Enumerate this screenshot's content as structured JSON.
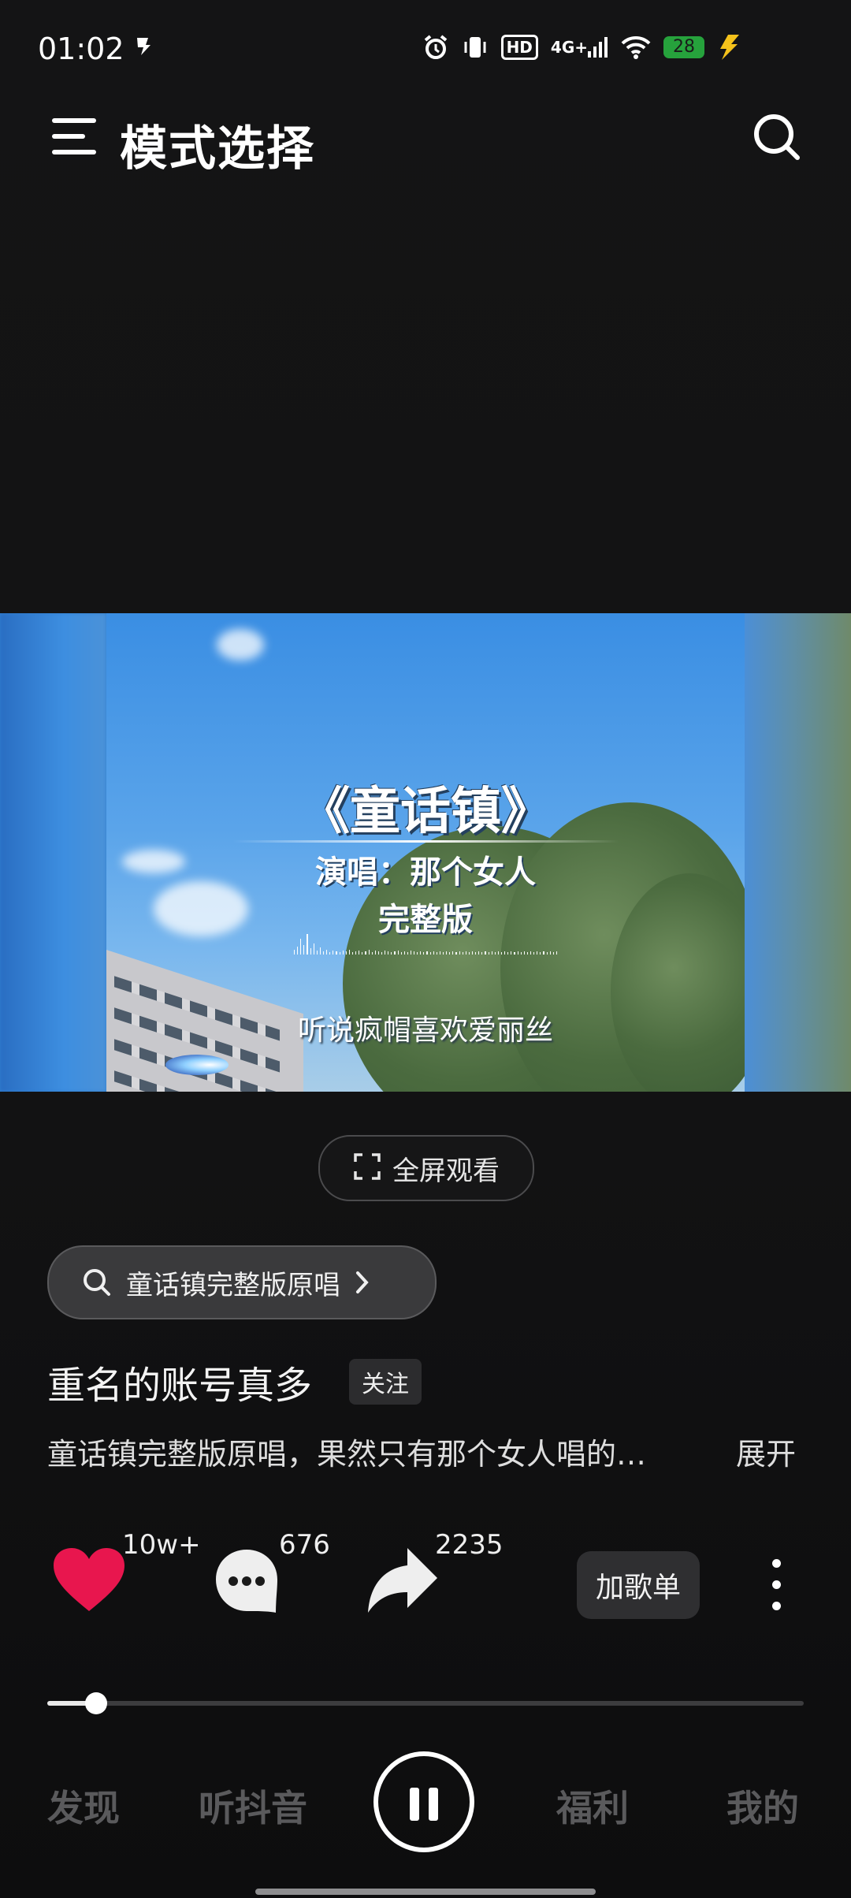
{
  "status_bar": {
    "time": "01:02",
    "network": "4G+",
    "hd": "HD",
    "battery": "28",
    "battery_color": "#26a23c",
    "icons": [
      "notification-icon",
      "alarm-icon",
      "vibrate-icon",
      "hd-icon",
      "signal-icon",
      "wifi-icon",
      "battery-icon",
      "charging-icon"
    ]
  },
  "header": {
    "title": "模式选择",
    "menu_icon": "menu-icon",
    "search_icon": "search-icon"
  },
  "video": {
    "title": "《童话镇》",
    "singer_line": "演唱：那个女人",
    "version_line": "完整版",
    "caption": "听说疯帽喜欢爱丽丝"
  },
  "fullscreen": {
    "label": "全屏观看",
    "icon": "fullscreen-icon"
  },
  "search_chip": {
    "label": "童话镇完整版原唱",
    "icon": "search-icon"
  },
  "author": {
    "name": "重名的账号真多",
    "follow_label": "关注"
  },
  "description": {
    "text": "童话镇完整版原唱，果然只有那个女人唱的…",
    "expand_label": "展开"
  },
  "actions": {
    "like_count": "10w+",
    "like_color": "#e8164e",
    "comment_count": "676",
    "share_count": "2235",
    "playlist_label": "加歌单"
  },
  "progress": {
    "fraction": 0.065
  },
  "bottom_nav": {
    "items": [
      "发现",
      "听抖音",
      "福利",
      "我的"
    ],
    "play_state": "pause-icon"
  }
}
